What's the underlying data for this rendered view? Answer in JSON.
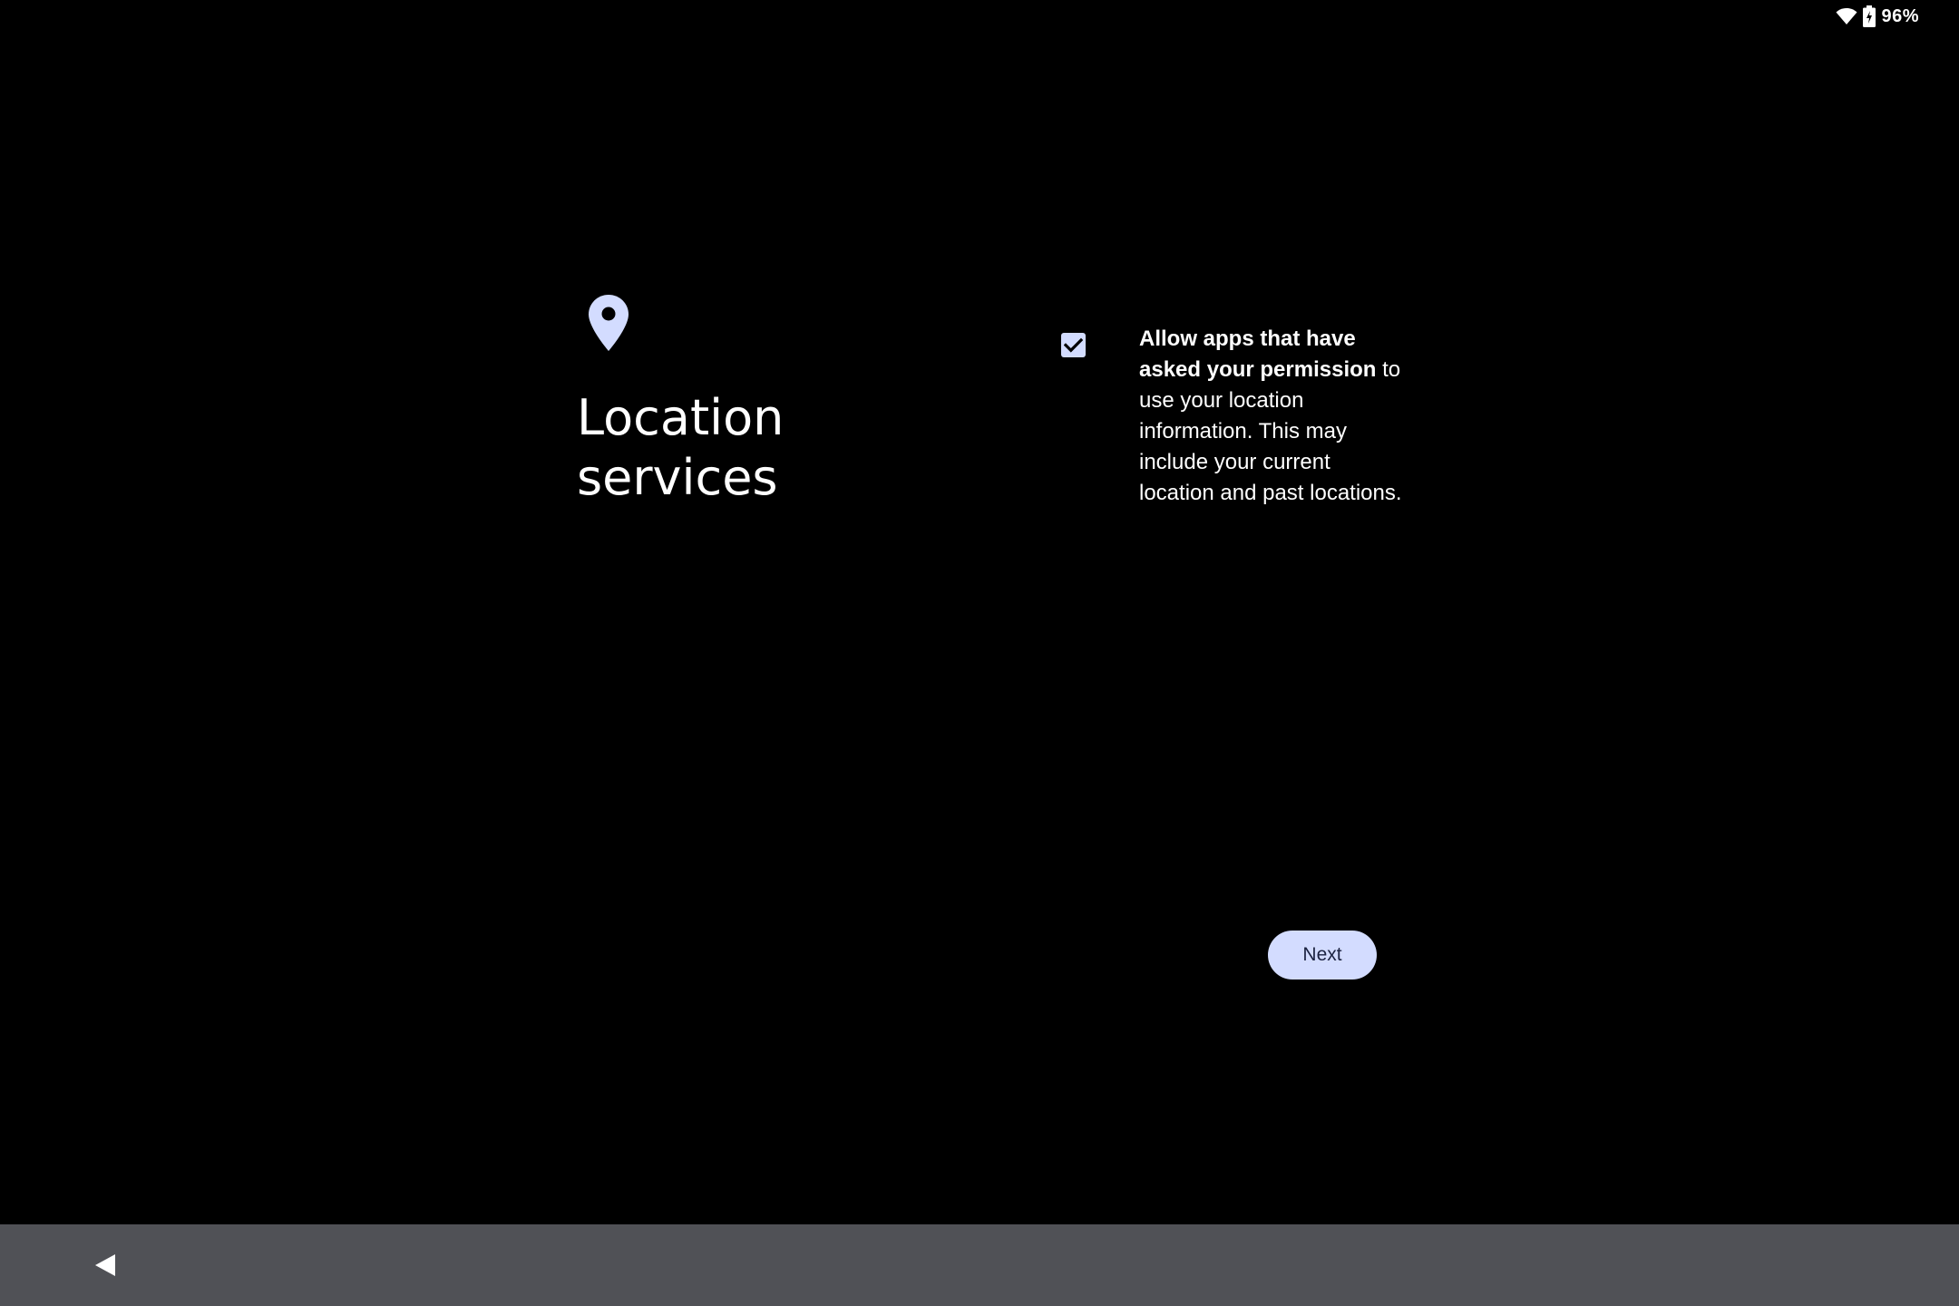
{
  "status_bar": {
    "wifi_icon": "wifi-icon",
    "battery_icon": "battery-charging-icon",
    "battery_level": "96%"
  },
  "main": {
    "icon": "location-pin-icon",
    "title": "Location\nservices",
    "checkbox": {
      "checked": true,
      "label_bold": "Allow apps that have asked your permission",
      "label_rest": " to use your location information. This may include your current location and past locations."
    },
    "next_label": "Next"
  },
  "nav_bar": {
    "back_icon": "back-triangle-icon"
  },
  "colors": {
    "background": "#000000",
    "accent": "#d3dcff",
    "nav_bar": "#505156",
    "button_text": "#1b2240"
  }
}
